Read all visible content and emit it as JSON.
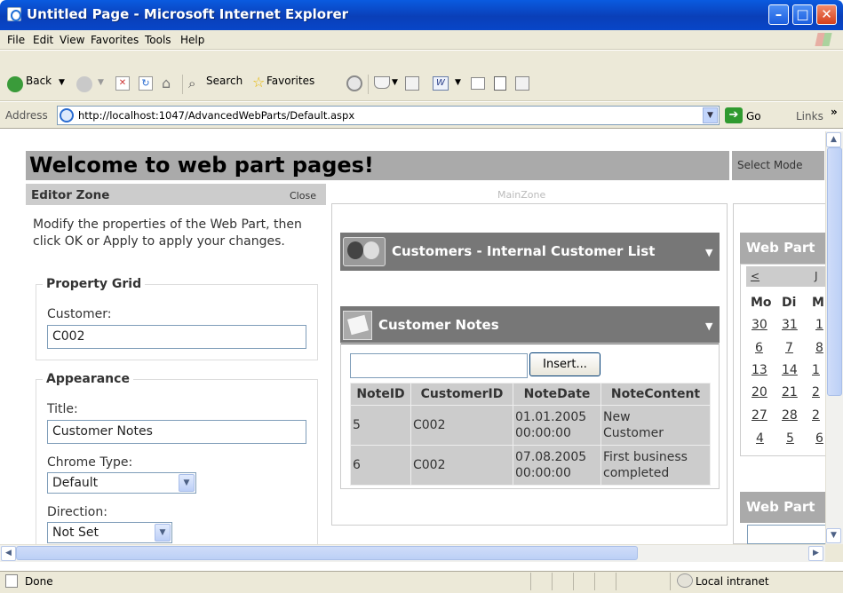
{
  "window": {
    "title": "Untitled Page - Microsoft Internet Explorer"
  },
  "menu": [
    "File",
    "Edit",
    "View",
    "Favorites",
    "Tools",
    "Help"
  ],
  "toolbar": {
    "back": "Back",
    "search": "Search",
    "favorites": "Favorites"
  },
  "address": {
    "label": "Address",
    "url": "http://localhost:1047/AdvancedWebParts/Default.aspx",
    "go": "Go",
    "links": "Links",
    "links_chevron": "»"
  },
  "status": {
    "text": "Done",
    "zone": "Local intranet"
  },
  "page": {
    "heading": "Welcome to web part pages!",
    "select_mode": "Select Mode",
    "editor": {
      "title": "Editor Zone",
      "close": "Close",
      "description": "Modify the properties of the Web Part, then click OK or Apply to apply your changes.",
      "property_grid": {
        "legend": "Property Grid",
        "customer_label": "Customer:",
        "customer_value": "C002"
      },
      "appearance": {
        "legend": "Appearance",
        "title_label": "Title:",
        "title_value": "Customer Notes",
        "chrome_label": "Chrome Type:",
        "chrome_value": "Default",
        "direction_label": "Direction:",
        "direction_value": "Not Set"
      }
    },
    "main_zone": {
      "title": "MainZone",
      "part1_title": "Customers - Internal Customer List",
      "part2_title": "Customer Notes",
      "insert_label": "Insert...",
      "table": {
        "columns": [
          "NoteID",
          "CustomerID",
          "NoteDate",
          "NoteContent"
        ],
        "rows": [
          {
            "id": "5",
            "customer": "C002",
            "date1": "01.01.2005",
            "date2": "00:00:00",
            "content1": "New",
            "content2": "Customer"
          },
          {
            "id": "6",
            "customer": "C002",
            "date1": "07.08.2005",
            "date2": "00:00:00",
            "content1": "First business",
            "content2": "completed"
          }
        ]
      }
    },
    "right_zone": {
      "calendar_title": "Web Part",
      "prev": "<",
      "month_partial": "J",
      "day_headers": [
        "Mo",
        "Di",
        "M"
      ],
      "weeks": [
        [
          "30",
          "31",
          "1"
        ],
        [
          "6",
          "7",
          "8"
        ],
        [
          "13",
          "14",
          "1"
        ],
        [
          "20",
          "21",
          "2"
        ],
        [
          "27",
          "28",
          "2"
        ],
        [
          "4",
          "5",
          "6"
        ]
      ],
      "part4_title": "Web Part"
    }
  }
}
